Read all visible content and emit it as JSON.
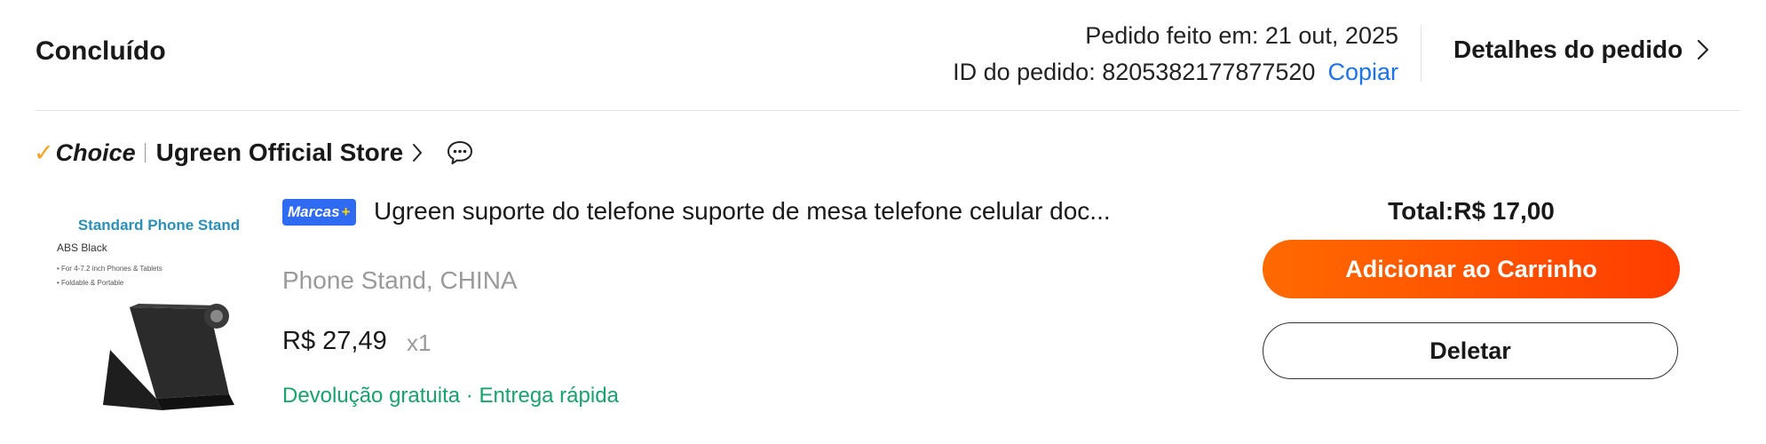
{
  "order": {
    "status": "Concluído",
    "date_text": "Pedido feito em: 21 out, 2025",
    "id_text": "ID do pedido: 8205382177877520",
    "copy_label": "Copiar",
    "details_label": "Detalhes do pedido"
  },
  "store": {
    "choice_label": "Choice",
    "name": "Ugreen Official Store"
  },
  "product": {
    "image_text": {
      "title": "Standard Phone Stand",
      "subtitle": "ABS Black",
      "bullet1": "• For 4-7.2 inch Phones & Tablets",
      "bullet2": "• Foldable & Portable"
    },
    "badge_label": "Marcas",
    "badge_plus": "+",
    "title": "Ugreen suporte do telefone suporte de mesa telefone celular doc...",
    "variant": "Phone Stand, CHINA",
    "price": "R$ 27,49",
    "quantity": "x1",
    "perks": "Devolução gratuita · Entrega rápida"
  },
  "summary": {
    "total": "Total:R$ 17,00",
    "add_to_cart_label": "Adicionar ao Carrinho",
    "delete_label": "Deletar"
  },
  "colors": {
    "accent_link": "#1a73e8",
    "primary_button": "#ff4b00",
    "perk_green": "#17a36b",
    "choice_check": "#f7a11c",
    "badge_blue": "#2f6bf2"
  }
}
